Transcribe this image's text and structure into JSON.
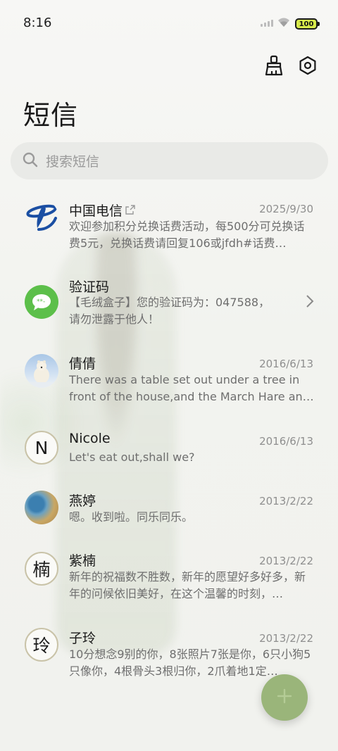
{
  "status_bar": {
    "time": "8:16",
    "battery": "100"
  },
  "header": {
    "title": "短信",
    "icons": [
      "clean-brush-icon",
      "settings-hex-icon"
    ]
  },
  "search": {
    "placeholder": "搜索短信",
    "icon": "search-icon"
  },
  "conversations": [
    {
      "name": "中国电信",
      "date": "2025/9/30",
      "preview": "欢迎参加积分兑换话费活动，每500分可兑换话费5元，兑换话费请回复106或jfdh#话费…",
      "avatar": "china-telecom-logo"
    },
    {
      "name": "验证码",
      "date": "",
      "preview": "【毛绒盒子】您的验证码为：047588，请勿泄露于他人！",
      "avatar": "message-bubble-icon"
    },
    {
      "name": "倩倩",
      "date": "2016/6/13",
      "preview": "There was a table set out under a tree in front of the house,and the March Hare an…",
      "avatar": "polar-bear-photo"
    },
    {
      "name": "Nicole",
      "date": "2016/6/13",
      "preview": "Let's eat out,shall we?",
      "avatar_letter": "N"
    },
    {
      "name": "燕婷",
      "date": "2013/2/22",
      "preview": "嗯。收到啦。同乐同乐。",
      "avatar": "landscape-photo"
    },
    {
      "name": "紫楠",
      "date": "2013/2/22",
      "preview": "新年的祝福数不胜数，新年的愿望好多好多，新年的问候依旧美好，在这个温馨的时刻，…",
      "avatar_letter": "楠"
    },
    {
      "name": "子玲",
      "date": "2013/2/22",
      "preview": "10分想念9别的你，8张照片7张是你，6只小狗5只像你，4根骨头3根归你，2爪着地1定…",
      "avatar_letter": "玲"
    }
  ],
  "fab": {
    "icon": "plus-icon"
  },
  "colors": {
    "accent": "#9ab57a",
    "verify_green": "#5cbf4a",
    "telecom_blue": "#1b4fa3"
  }
}
